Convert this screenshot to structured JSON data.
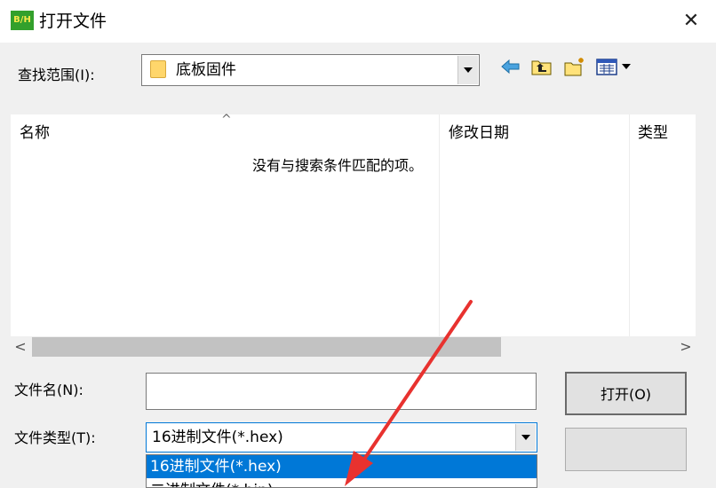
{
  "window": {
    "icon_text": "B/H",
    "title": "打开文件",
    "close_glyph": "✕"
  },
  "lookin": {
    "label": "查找范围(I):",
    "value": "底板固件"
  },
  "toolbar": {
    "icons": [
      "back-icon",
      "up-folder-icon",
      "new-folder-icon",
      "view-menu-icon"
    ]
  },
  "filelist": {
    "columns": [
      "名称",
      "修改日期",
      "类型"
    ],
    "empty_message": "没有与搜索条件匹配的项。",
    "sort_glyph": "^"
  },
  "scrollbar": {
    "left_glyph": "<",
    "right_glyph": ">"
  },
  "filename": {
    "label": "文件名(N):",
    "value": ""
  },
  "filetype": {
    "label": "文件类型(T):",
    "value": "16进制文件(*.hex)",
    "options": [
      "16进制文件(*.hex)",
      "二进制文件(*.bin)"
    ]
  },
  "buttons": {
    "open": "打开(O)",
    "cancel": ""
  },
  "colors": {
    "accent": "#0078d7",
    "annotation_arrow": "#e8322f",
    "folder": "#ffd66b"
  }
}
